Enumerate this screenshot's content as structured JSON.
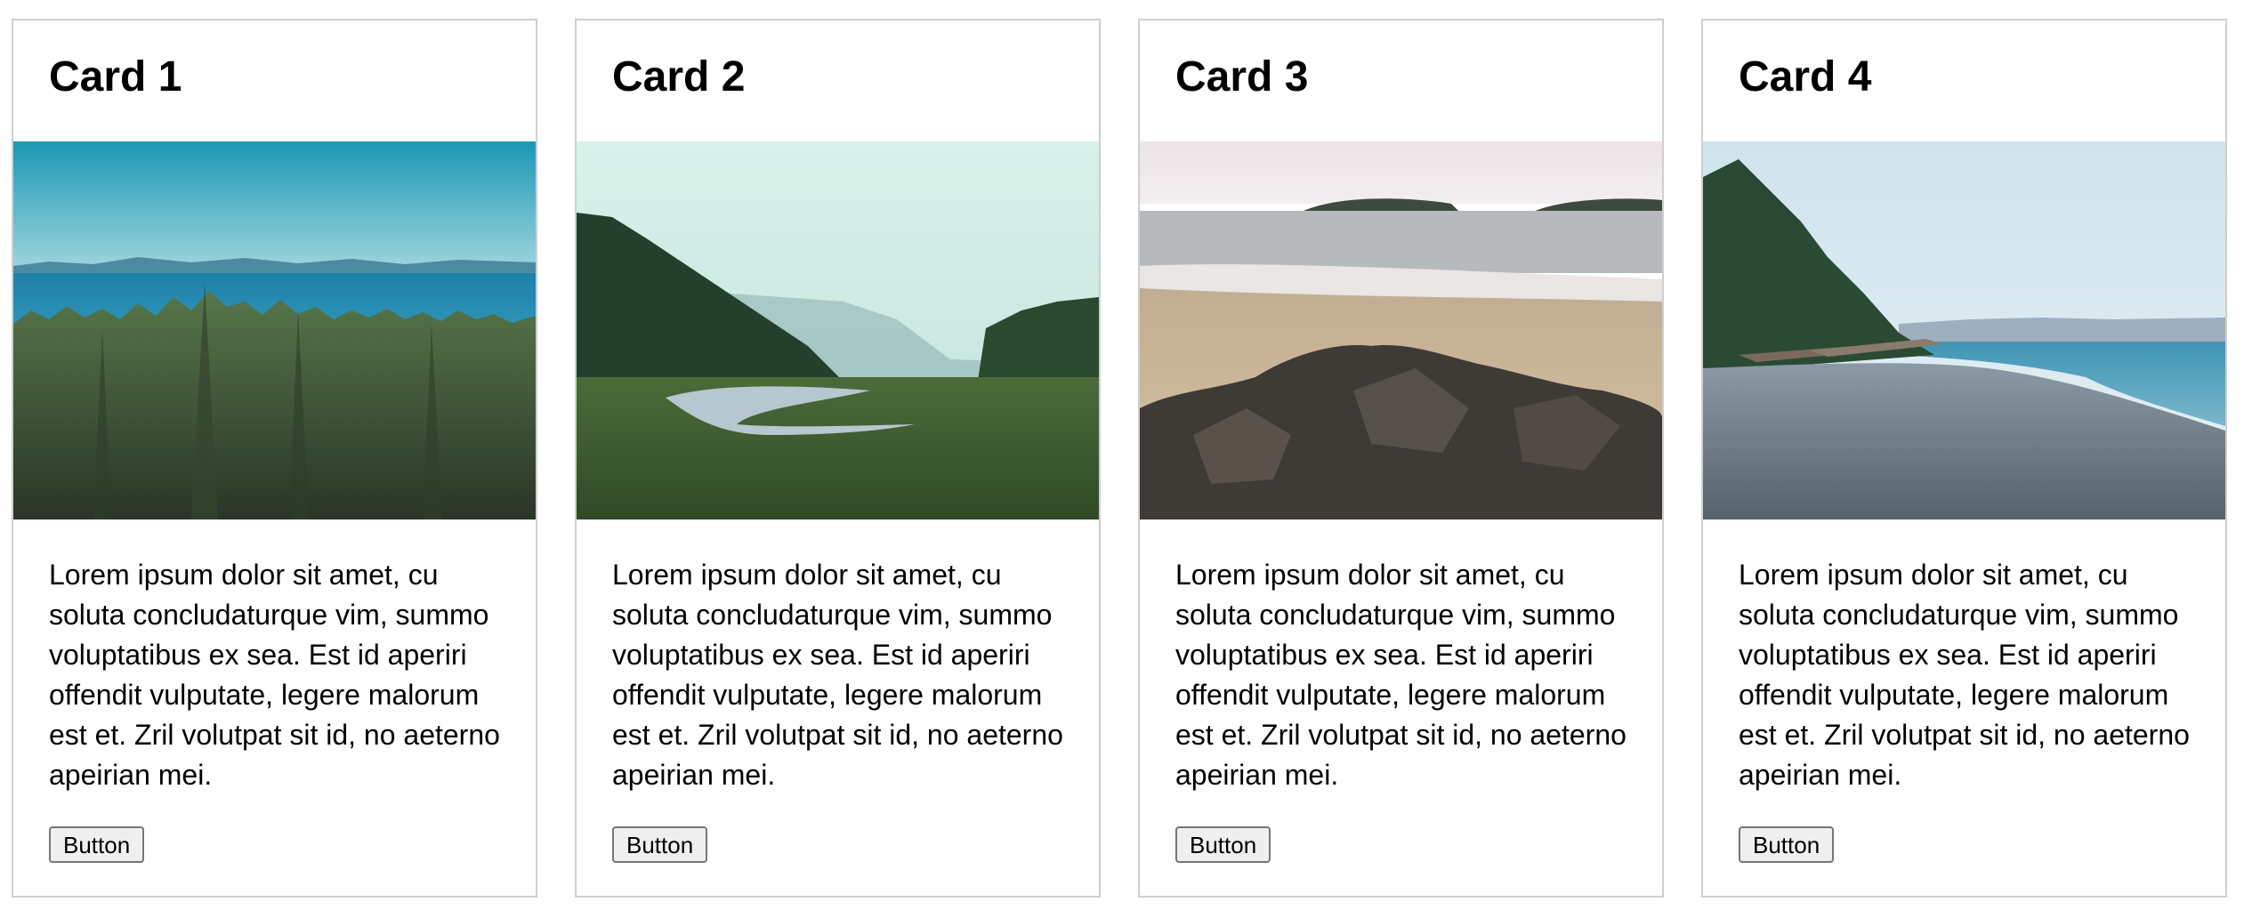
{
  "cards": [
    {
      "title": "Card 1",
      "image_icon": "forest-ocean-landscape-image",
      "body": "Lorem ipsum dolor sit amet, cu soluta concludaturque vim, summo voluptatibus ex sea. Est id aperiri offendit vulputate, legere malorum est et. Zril volutpat sit id, no aeterno apeirian mei.",
      "button_label": "Button"
    },
    {
      "title": "Card 2",
      "image_icon": "river-valley-landscape-image",
      "body": "Lorem ipsum dolor sit amet, cu soluta concludaturque vim, summo voluptatibus ex sea. Est id aperiri offendit vulputate, legere malorum est et. Zril volutpat sit id, no aeterno apeirian mei.",
      "button_label": "Button"
    },
    {
      "title": "Card 3",
      "image_icon": "beach-rocks-landscape-image",
      "body": "Lorem ipsum dolor sit amet, cu soluta concludaturque vim, summo voluptatibus ex sea. Est id aperiri offendit vulputate, legere malorum est et. Zril volutpat sit id, no aeterno apeirian mei.",
      "button_label": "Button"
    },
    {
      "title": "Card 4",
      "image_icon": "pebble-shore-landscape-image",
      "body": "Lorem ipsum dolor sit amet, cu soluta concludaturque vim, summo voluptatibus ex sea. Est id aperiri offendit vulputate, legere malorum est et. Zril volutpat sit id, no aeterno apeirian mei.",
      "button_label": "Button"
    }
  ],
  "colors": {
    "card_border": "#cfcfcf",
    "button_background": "#efefef",
    "button_border": "#767676"
  }
}
